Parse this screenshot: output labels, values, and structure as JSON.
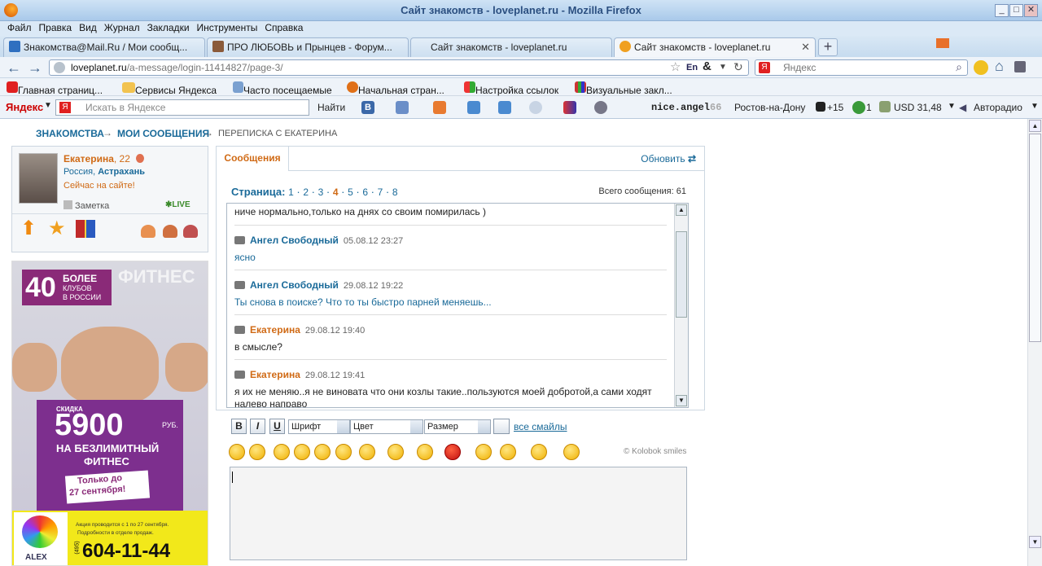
{
  "window": {
    "title": "Сайт знакомств - loveplanet.ru - Mozilla Firefox"
  },
  "menu": [
    "Файл",
    "Правка",
    "Вид",
    "Журнал",
    "Закладки",
    "Инструменты",
    "Справка"
  ],
  "tabs": [
    {
      "label": "Знакомства@Mail.Ru / Мои сообщ...",
      "active": false
    },
    {
      "label": "ПРО ЛЮБОВЬ и Прынцев - Форум...",
      "active": false
    },
    {
      "label": "Сайт знакомств - loveplanet.ru",
      "active": false
    },
    {
      "label": "Сайт знакомств - loveplanet.ru",
      "active": true
    }
  ],
  "nav": {
    "url_domain": "loveplanet.ru",
    "url_path": "/a-message/login-11414827/page-3/",
    "search_placeholder": "Яндекс",
    "lang": "En"
  },
  "bookmarks": [
    "Главная страниц...",
    "Сервисы Яндекса",
    "Часто посещаемые",
    "Начальная стран...",
    "Настройка ссылок",
    "Визуальные закл..."
  ],
  "yandex": {
    "logo": "Яндекс",
    "search_placeholder": "Искать в Яндексе",
    "find": "Найти",
    "user": "nice.angel",
    "user_num": "66",
    "city": "Ростов-на-Дону",
    "weather": "+15",
    "badge": "1",
    "currency": "USD 31,48",
    "radio": "Авторадио"
  },
  "breadcrumb": {
    "a": "ЗНАКОМСТВА",
    "b": "МОИ СООБЩЕНИЯ",
    "c": "ПЕРЕПИСКА С ЕКАТЕРИНА"
  },
  "profile": {
    "name": "Екатерина",
    "age": ", 22",
    "country": "Россия, ",
    "city": "Астрахань",
    "status": "Сейчас на сайте!",
    "note": "Заметка",
    "live": "LIVE"
  },
  "ad": {
    "num": "40",
    "more": "БОЛЕЕ",
    "clubs": "КЛУБОВ",
    "inrus": "В РОССИИ",
    "fitness": "ФИТНЕС",
    "discount": "СКИДКА",
    "price": "5900",
    "rub": "РУБ.",
    "unlimited": "НА БЕЗЛИМИТНЫЙ",
    "fitness2": "ФИТНЕС",
    "only": "Только до",
    "date": "27 сентября!",
    "action": "Акция проводится с 1 по 27 сентября.",
    "details": "Подробности в отделе продаж.",
    "code": "(495)",
    "phone": "604-11-44",
    "brand": "ALEX"
  },
  "panel": {
    "tab": "Сообщения",
    "refresh": "Обновить",
    "page_label": "Страница:",
    "pages": [
      "1",
      "2",
      "3",
      "4",
      "5",
      "6",
      "7",
      "8"
    ],
    "current_page": "4",
    "total": "Всего сообщения: 61"
  },
  "messages": [
    {
      "author": "",
      "date": "",
      "text": "ниче нормально,только на днях со своим помирилась )"
    },
    {
      "author": "Ангел Свободный",
      "date": "05.08.12 23:27",
      "text": "ясно"
    },
    {
      "author": "Ангел Свободный",
      "date": "29.08.12 19:22",
      "text": "Ты снова в поиске? Что то ты быстро парней меняешь..."
    },
    {
      "author": "Екатерина",
      "date": "29.08.12 19:40",
      "text": "в смысле?"
    },
    {
      "author": "Екатерина",
      "date": "29.08.12 19:41",
      "text": "я их не меняю..я не виновата что они козлы такие..пользуются моей добротой,а сами ходят налево направо"
    }
  ],
  "editor": {
    "bold": "B",
    "italic": "I",
    "underline": "U",
    "font": "Шрифт",
    "color": "Цвет",
    "size": "Размер",
    "all_smiles": "все смайлы",
    "credit": "© Kolobok smiles"
  }
}
